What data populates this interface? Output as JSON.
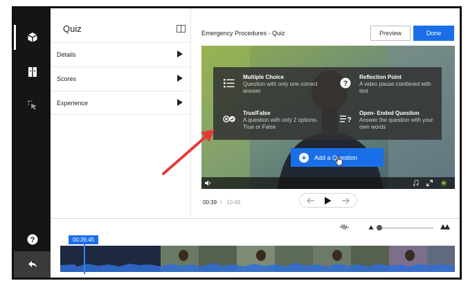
{
  "panel": {
    "title": "Quiz",
    "rows": [
      {
        "label": "Details"
      },
      {
        "label": "Scores"
      },
      {
        "label": "Experience"
      }
    ]
  },
  "main": {
    "title": "Emergency Procedures - Quiz",
    "preview_label": "Preview",
    "done_label": "Done"
  },
  "question_menu": {
    "options": [
      {
        "title": "Multiple Choice",
        "desc": "Question with only one correct answer",
        "icon": "list-icon"
      },
      {
        "title": "Reflection Point",
        "desc": "A video pause combined with text",
        "icon": "question-badge-icon"
      },
      {
        "title": "True/False",
        "desc": "A question with only 2 options- True or False",
        "icon": "true-false-icon"
      },
      {
        "title": "Open- Ended Question",
        "desc": "Answer the question with your own words",
        "icon": "open-text-icon"
      }
    ]
  },
  "add_question_label": "Add a Question",
  "player": {
    "current_time": "00:39",
    "separator": "/",
    "duration": "10:49"
  },
  "timeline": {
    "playhead_time": "00:39.45"
  },
  "colors": {
    "accent": "#1a6fe8",
    "rail": "#151515",
    "arrow": "#e53935"
  }
}
